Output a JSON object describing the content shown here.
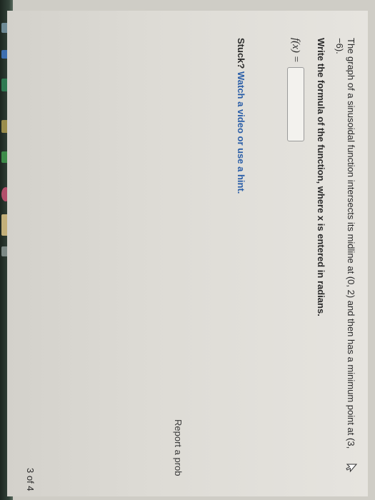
{
  "question": {
    "text": "The graph of a sinusoidal function intersects its midline at (0, 2) and then has a minimum point at (3, −6).",
    "instruction": "Write the formula of the function, where x is entered in radians.",
    "function_label": "f(x) =",
    "answer_value": ""
  },
  "help": {
    "stuck_text": "Stuck?",
    "link_text": "Watch a video or use a hint."
  },
  "footer": {
    "report_text": "Report a prob",
    "page_counter": "3 of 4"
  },
  "icons": {
    "cursor": "cursor-arrow-icon"
  },
  "colors": {
    "link": "#2c5fa8",
    "page_bg": "#e6e4df",
    "text": "#2b2b2b"
  }
}
